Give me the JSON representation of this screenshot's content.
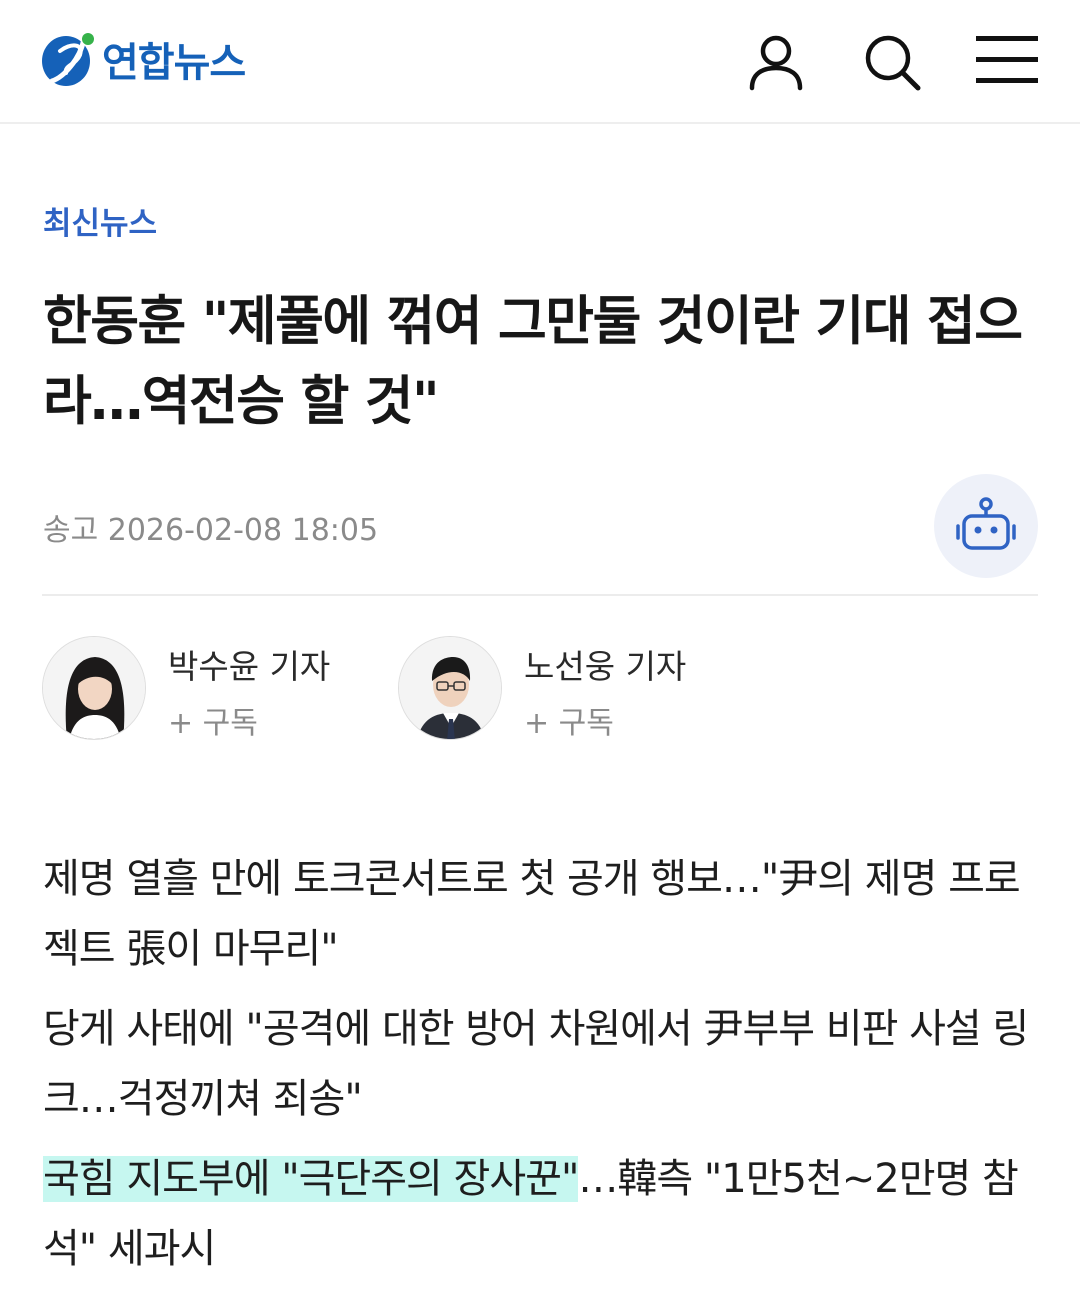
{
  "header": {
    "logo_text": "연합뉴스",
    "icons": [
      "user-icon",
      "search-icon",
      "menu-icon"
    ]
  },
  "article": {
    "category": "최신뉴스",
    "title": "한동훈 \"제풀에 꺾여 그만둘 것이란 기대 접으라…역전승 할 것\"",
    "date_label": "송고 2026-02-08 18:05"
  },
  "ai_button": {
    "icon": "robot-icon"
  },
  "reporters": [
    {
      "name": "박수윤 기자",
      "subscribe": "+ 구독"
    },
    {
      "name": "노선웅 기자",
      "subscribe": "+ 구독"
    }
  ],
  "related": [
    {
      "text": "제명 열흘 만에 토크콘서트로 첫 공개 행보…\"尹의 제명 프로젝트 張이 마무리\""
    },
    {
      "text": "당게 사태에 \"공격에 대한 방어 차원에서 尹부부 비판 사설 링크…걱정끼쳐 죄송\""
    },
    {
      "highlight": "국힘 지도부에 \"극단주의 장사꾼\"",
      "rest": "…韓측 \"1만5천~2만명 참석\" 세과시"
    }
  ],
  "colors": {
    "brand": "#1561b8",
    "category": "#2f63c4",
    "highlight": "#c6f7f0",
    "ai_button_bg": "#eef1f9"
  }
}
